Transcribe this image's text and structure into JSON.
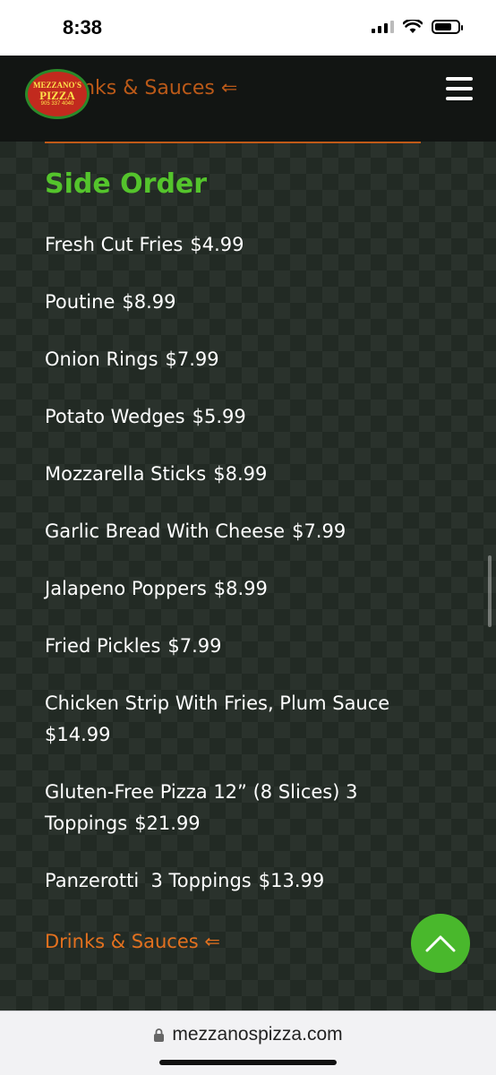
{
  "status_bar": {
    "time": "8:38",
    "icons": [
      "signal-icon",
      "wifi-icon",
      "battery-icon"
    ]
  },
  "header": {
    "logo": {
      "top": "MEZZANO'S",
      "main": "PIZZA",
      "phone": "905 337 4040"
    },
    "link_label": "Drinks & Sauces ⇐",
    "menu_icon": "hamburger-menu-icon"
  },
  "section": {
    "title": "Side Order",
    "items": [
      {
        "name": "Fresh Cut Fries",
        "price": "$4.99"
      },
      {
        "name": "Poutine",
        "price": "$8.99"
      },
      {
        "name": "Onion Rings",
        "price": "$7.99"
      },
      {
        "name": "Potato Wedges",
        "price": "$5.99"
      },
      {
        "name": "Mozzarella Sticks",
        "price": "$8.99"
      },
      {
        "name": "Garlic Bread With Cheese",
        "price": "$7.99"
      },
      {
        "name": "Jalapeno Poppers",
        "price": "$8.99"
      },
      {
        "name": "Fried Pickles",
        "price": "$7.99"
      },
      {
        "name": "Chicken Strip With Fries, Plum Sauce",
        "price": "$14.99"
      },
      {
        "name": "Gluten-Free Pizza 12” (8 Slices) 3 Toppings",
        "price": "$21.99"
      },
      {
        "name": "Panzerotti  3 Toppings",
        "price": "$13.99"
      }
    ]
  },
  "footer_link": "Drinks & Sauces ⇐",
  "back_to_top_icon": "chevron-up-icon",
  "browser": {
    "url": "mezzanospizza.com",
    "lock_icon": "lock-icon"
  },
  "colors": {
    "accent_green": "#54c42c",
    "accent_orange": "#e3711f",
    "header_bg": "#121513",
    "content_bg": "#222a24"
  }
}
